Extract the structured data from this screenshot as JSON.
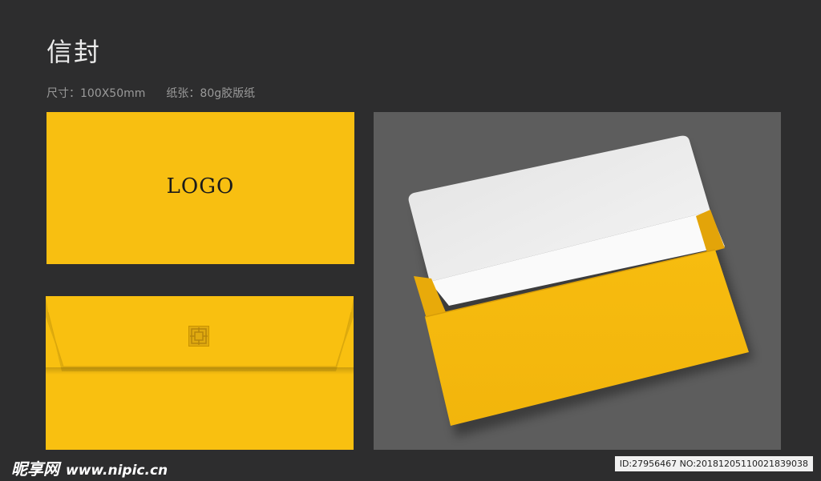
{
  "header": {
    "title": "信封",
    "size_label": "尺寸：100X50mm",
    "paper_label": "纸张：80g胶版纸"
  },
  "front": {
    "logo_text": "LOGO",
    "color": "#f8bf11"
  },
  "back": {
    "color": "#f9c010",
    "seal_icon": "seal-pattern-icon"
  },
  "mockup": {
    "background": "#5d5d5d",
    "envelope_color": "#f8bf11",
    "inner_color": "#f2f2f2"
  },
  "watermark": {
    "brand": "昵享网",
    "url": "www.nipic.cn",
    "id_text": "ID:27956467 NO:20181205110021839038"
  }
}
